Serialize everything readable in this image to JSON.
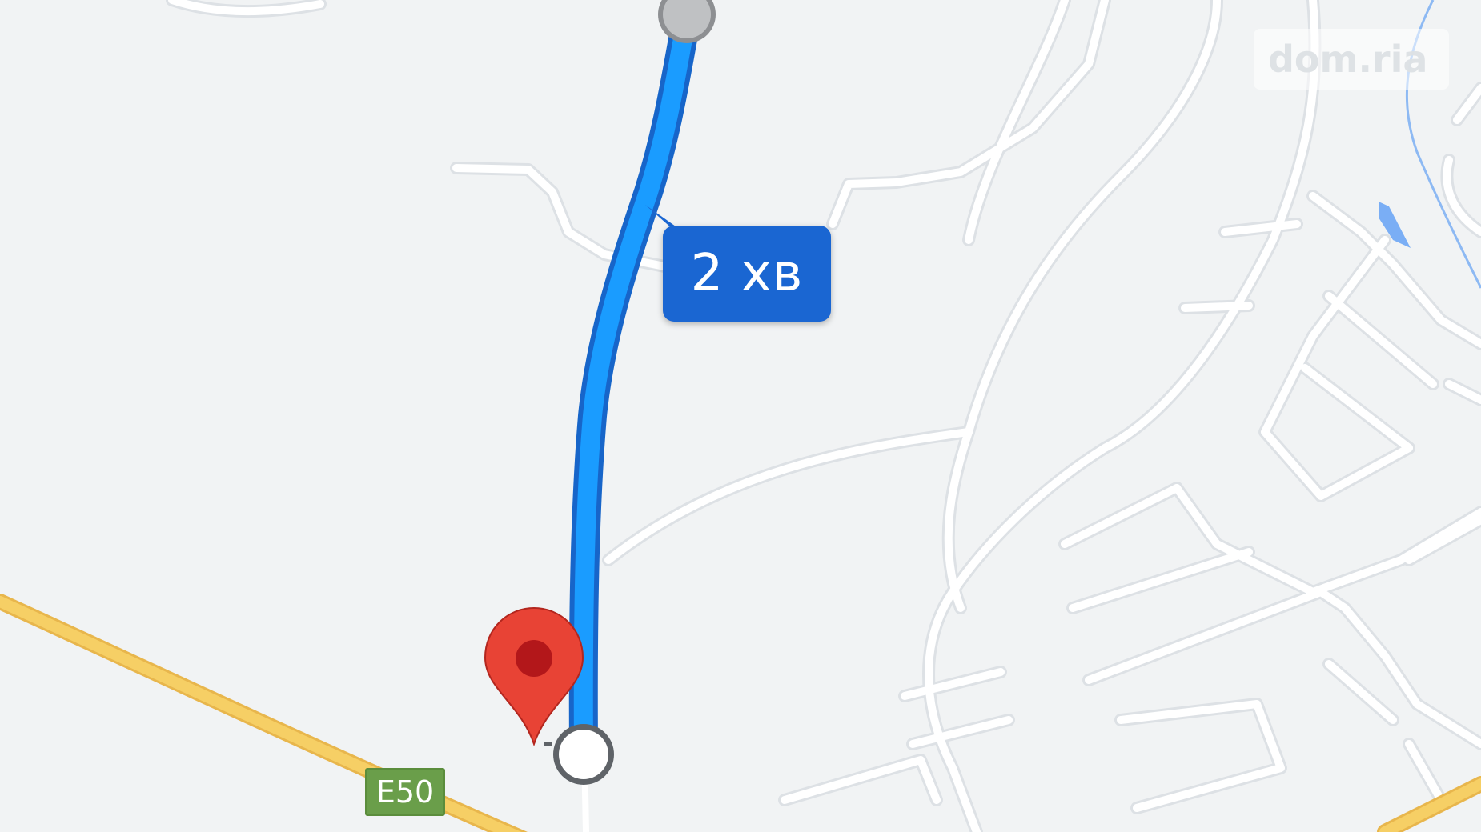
{
  "map": {
    "route_duration_label": "2 хв",
    "highway_shield": "E50",
    "watermark": "dom.ria",
    "icons": {
      "route_origin": "route-start-circle-icon",
      "route_end": "route-end-circle-icon",
      "destination_pin": "map-pin-icon"
    },
    "colors": {
      "background": "#f1f3f4",
      "minor_road": "#ffffff",
      "minor_road_casing": "#dde1e5",
      "highway": "#f6cf65",
      "highway_casing": "#e8b64c",
      "route": "#1a9cff",
      "route_casing": "#1765c9",
      "label_background": "#1a66d2",
      "pin": "#e84335",
      "water": "#7aaef5",
      "shield": "#6a9e4a"
    }
  }
}
